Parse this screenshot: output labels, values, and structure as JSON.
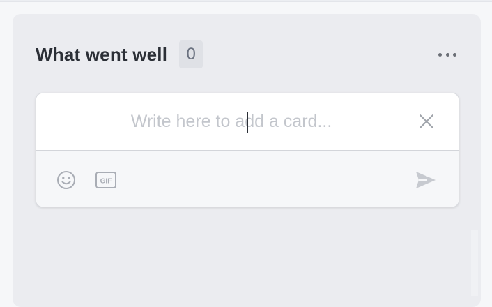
{
  "column": {
    "title": "What went well",
    "count": "0",
    "more_icon": "more-horizontal-icon"
  },
  "composer": {
    "placeholder": "Write here to add a card...",
    "value": "",
    "close_icon": "close-icon",
    "toolbar": {
      "emoji_icon": "emoji-smile-icon",
      "gif_label": "GIF",
      "send_icon": "send-icon"
    }
  },
  "colors": {
    "column_bg": "#ebecf0",
    "title": "#2b2f36",
    "count_bg": "#dfe1e6",
    "icon_grey": "#a9adb5",
    "send_grey": "#c7cad0"
  }
}
